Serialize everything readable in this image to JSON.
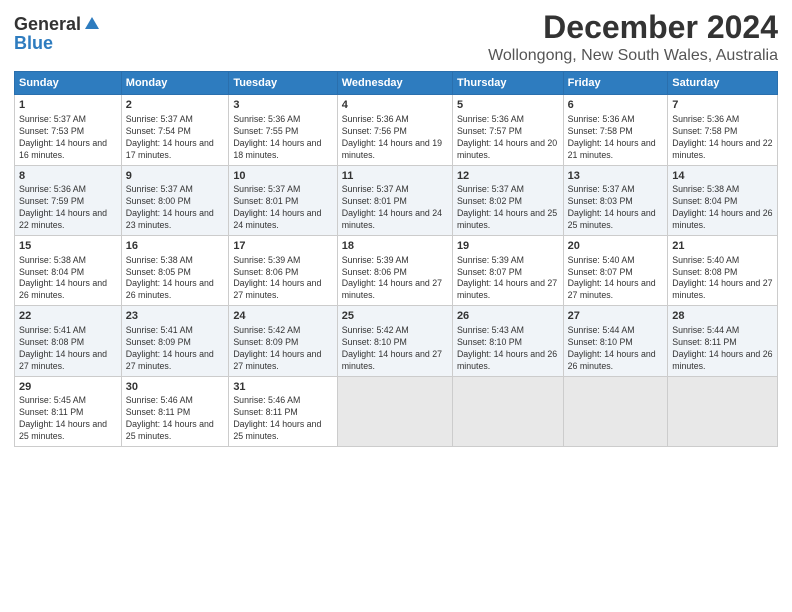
{
  "logo": {
    "general": "General",
    "blue": "Blue"
  },
  "title": "December 2024",
  "subtitle": "Wollongong, New South Wales, Australia",
  "days_of_week": [
    "Sunday",
    "Monday",
    "Tuesday",
    "Wednesday",
    "Thursday",
    "Friday",
    "Saturday"
  ],
  "weeks": [
    [
      {
        "day": "1",
        "sunrise": "Sunrise: 5:37 AM",
        "sunset": "Sunset: 7:53 PM",
        "daylight": "Daylight: 14 hours and 16 minutes."
      },
      {
        "day": "2",
        "sunrise": "Sunrise: 5:37 AM",
        "sunset": "Sunset: 7:54 PM",
        "daylight": "Daylight: 14 hours and 17 minutes."
      },
      {
        "day": "3",
        "sunrise": "Sunrise: 5:36 AM",
        "sunset": "Sunset: 7:55 PM",
        "daylight": "Daylight: 14 hours and 18 minutes."
      },
      {
        "day": "4",
        "sunrise": "Sunrise: 5:36 AM",
        "sunset": "Sunset: 7:56 PM",
        "daylight": "Daylight: 14 hours and 19 minutes."
      },
      {
        "day": "5",
        "sunrise": "Sunrise: 5:36 AM",
        "sunset": "Sunset: 7:57 PM",
        "daylight": "Daylight: 14 hours and 20 minutes."
      },
      {
        "day": "6",
        "sunrise": "Sunrise: 5:36 AM",
        "sunset": "Sunset: 7:58 PM",
        "daylight": "Daylight: 14 hours and 21 minutes."
      },
      {
        "day": "7",
        "sunrise": "Sunrise: 5:36 AM",
        "sunset": "Sunset: 7:58 PM",
        "daylight": "Daylight: 14 hours and 22 minutes."
      }
    ],
    [
      {
        "day": "8",
        "sunrise": "Sunrise: 5:36 AM",
        "sunset": "Sunset: 7:59 PM",
        "daylight": "Daylight: 14 hours and 22 minutes."
      },
      {
        "day": "9",
        "sunrise": "Sunrise: 5:37 AM",
        "sunset": "Sunset: 8:00 PM",
        "daylight": "Daylight: 14 hours and 23 minutes."
      },
      {
        "day": "10",
        "sunrise": "Sunrise: 5:37 AM",
        "sunset": "Sunset: 8:01 PM",
        "daylight": "Daylight: 14 hours and 24 minutes."
      },
      {
        "day": "11",
        "sunrise": "Sunrise: 5:37 AM",
        "sunset": "Sunset: 8:01 PM",
        "daylight": "Daylight: 14 hours and 24 minutes."
      },
      {
        "day": "12",
        "sunrise": "Sunrise: 5:37 AM",
        "sunset": "Sunset: 8:02 PM",
        "daylight": "Daylight: 14 hours and 25 minutes."
      },
      {
        "day": "13",
        "sunrise": "Sunrise: 5:37 AM",
        "sunset": "Sunset: 8:03 PM",
        "daylight": "Daylight: 14 hours and 25 minutes."
      },
      {
        "day": "14",
        "sunrise": "Sunrise: 5:38 AM",
        "sunset": "Sunset: 8:04 PM",
        "daylight": "Daylight: 14 hours and 26 minutes."
      }
    ],
    [
      {
        "day": "15",
        "sunrise": "Sunrise: 5:38 AM",
        "sunset": "Sunset: 8:04 PM",
        "daylight": "Daylight: 14 hours and 26 minutes."
      },
      {
        "day": "16",
        "sunrise": "Sunrise: 5:38 AM",
        "sunset": "Sunset: 8:05 PM",
        "daylight": "Daylight: 14 hours and 26 minutes."
      },
      {
        "day": "17",
        "sunrise": "Sunrise: 5:39 AM",
        "sunset": "Sunset: 8:06 PM",
        "daylight": "Daylight: 14 hours and 27 minutes."
      },
      {
        "day": "18",
        "sunrise": "Sunrise: 5:39 AM",
        "sunset": "Sunset: 8:06 PM",
        "daylight": "Daylight: 14 hours and 27 minutes."
      },
      {
        "day": "19",
        "sunrise": "Sunrise: 5:39 AM",
        "sunset": "Sunset: 8:07 PM",
        "daylight": "Daylight: 14 hours and 27 minutes."
      },
      {
        "day": "20",
        "sunrise": "Sunrise: 5:40 AM",
        "sunset": "Sunset: 8:07 PM",
        "daylight": "Daylight: 14 hours and 27 minutes."
      },
      {
        "day": "21",
        "sunrise": "Sunrise: 5:40 AM",
        "sunset": "Sunset: 8:08 PM",
        "daylight": "Daylight: 14 hours and 27 minutes."
      }
    ],
    [
      {
        "day": "22",
        "sunrise": "Sunrise: 5:41 AM",
        "sunset": "Sunset: 8:08 PM",
        "daylight": "Daylight: 14 hours and 27 minutes."
      },
      {
        "day": "23",
        "sunrise": "Sunrise: 5:41 AM",
        "sunset": "Sunset: 8:09 PM",
        "daylight": "Daylight: 14 hours and 27 minutes."
      },
      {
        "day": "24",
        "sunrise": "Sunrise: 5:42 AM",
        "sunset": "Sunset: 8:09 PM",
        "daylight": "Daylight: 14 hours and 27 minutes."
      },
      {
        "day": "25",
        "sunrise": "Sunrise: 5:42 AM",
        "sunset": "Sunset: 8:10 PM",
        "daylight": "Daylight: 14 hours and 27 minutes."
      },
      {
        "day": "26",
        "sunrise": "Sunrise: 5:43 AM",
        "sunset": "Sunset: 8:10 PM",
        "daylight": "Daylight: 14 hours and 26 minutes."
      },
      {
        "day": "27",
        "sunrise": "Sunrise: 5:44 AM",
        "sunset": "Sunset: 8:10 PM",
        "daylight": "Daylight: 14 hours and 26 minutes."
      },
      {
        "day": "28",
        "sunrise": "Sunrise: 5:44 AM",
        "sunset": "Sunset: 8:11 PM",
        "daylight": "Daylight: 14 hours and 26 minutes."
      }
    ],
    [
      {
        "day": "29",
        "sunrise": "Sunrise: 5:45 AM",
        "sunset": "Sunset: 8:11 PM",
        "daylight": "Daylight: 14 hours and 25 minutes."
      },
      {
        "day": "30",
        "sunrise": "Sunrise: 5:46 AM",
        "sunset": "Sunset: 8:11 PM",
        "daylight": "Daylight: 14 hours and 25 minutes."
      },
      {
        "day": "31",
        "sunrise": "Sunrise: 5:46 AM",
        "sunset": "Sunset: 8:11 PM",
        "daylight": "Daylight: 14 hours and 25 minutes."
      },
      null,
      null,
      null,
      null
    ]
  ]
}
